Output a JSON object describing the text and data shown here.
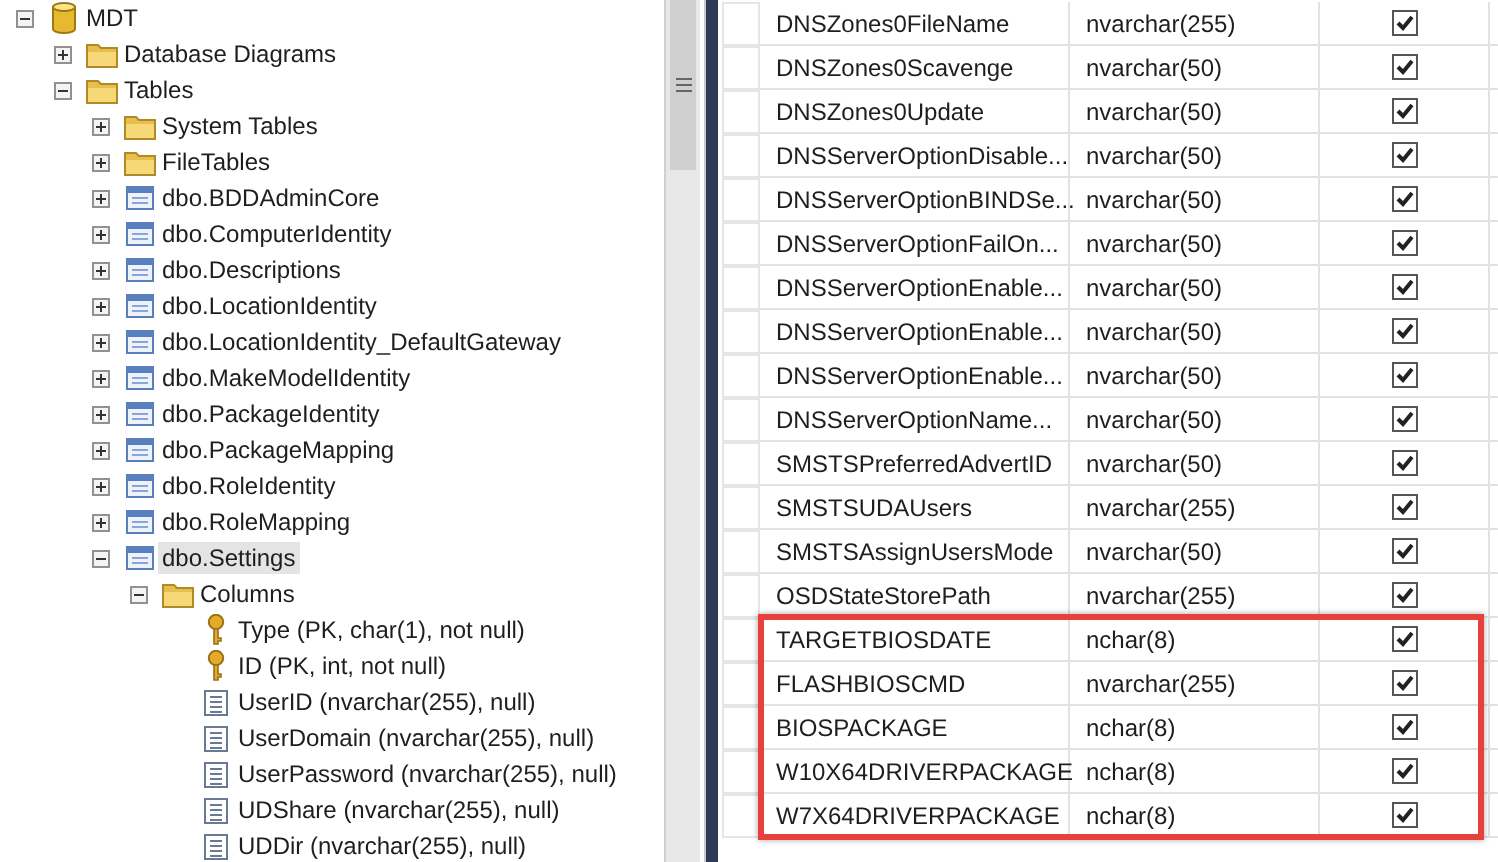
{
  "tree": [
    {
      "label": "MDT",
      "kind": "database",
      "expanded": true,
      "selected": false,
      "children": [
        {
          "label": "Database Diagrams",
          "kind": "folder",
          "expanded": false,
          "selected": false
        },
        {
          "label": "Tables",
          "kind": "folder",
          "expanded": true,
          "selected": false,
          "children": [
            {
              "label": "System Tables",
              "kind": "folder",
              "expanded": false,
              "selected": false
            },
            {
              "label": "FileTables",
              "kind": "folder",
              "expanded": false,
              "selected": false
            },
            {
              "label": "dbo.BDDAdminCore",
              "kind": "table",
              "expanded": false,
              "selected": false
            },
            {
              "label": "dbo.ComputerIdentity",
              "kind": "table",
              "expanded": false,
              "selected": false
            },
            {
              "label": "dbo.Descriptions",
              "kind": "table",
              "expanded": false,
              "selected": false
            },
            {
              "label": "dbo.LocationIdentity",
              "kind": "table",
              "expanded": false,
              "selected": false
            },
            {
              "label": "dbo.LocationIdentity_DefaultGateway",
              "kind": "table",
              "expanded": false,
              "selected": false
            },
            {
              "label": "dbo.MakeModelIdentity",
              "kind": "table",
              "expanded": false,
              "selected": false
            },
            {
              "label": "dbo.PackageIdentity",
              "kind": "table",
              "expanded": false,
              "selected": false
            },
            {
              "label": "dbo.PackageMapping",
              "kind": "table",
              "expanded": false,
              "selected": false
            },
            {
              "label": "dbo.RoleIdentity",
              "kind": "table",
              "expanded": false,
              "selected": false
            },
            {
              "label": "dbo.RoleMapping",
              "kind": "table",
              "expanded": false,
              "selected": false
            },
            {
              "label": "dbo.Settings",
              "kind": "table",
              "expanded": true,
              "selected": true,
              "children": [
                {
                  "label": "Columns",
                  "kind": "folder",
                  "expanded": true,
                  "selected": false,
                  "children": [
                    {
                      "label": "Type (PK, char(1), not null)",
                      "kind": "key",
                      "selected": false
                    },
                    {
                      "label": "ID (PK, int, not null)",
                      "kind": "key",
                      "selected": false
                    },
                    {
                      "label": "UserID (nvarchar(255), null)",
                      "kind": "column",
                      "selected": false
                    },
                    {
                      "label": "UserDomain (nvarchar(255), null)",
                      "kind": "column",
                      "selected": false
                    },
                    {
                      "label": "UserPassword (nvarchar(255), null)",
                      "kind": "column",
                      "selected": false
                    },
                    {
                      "label": "UDShare (nvarchar(255), null)",
                      "kind": "column",
                      "selected": false
                    },
                    {
                      "label": "UDDir (nvarchar(255), null)",
                      "kind": "column",
                      "selected": false
                    }
                  ]
                }
              ]
            }
          ]
        }
      ]
    }
  ],
  "columns_grid": {
    "rows": [
      {
        "name": "DNSZones0FileName",
        "type": "nvarchar(255)",
        "allow_nulls": true,
        "highlighted": false
      },
      {
        "name": "DNSZones0Scavenge",
        "type": "nvarchar(50)",
        "allow_nulls": true,
        "highlighted": false
      },
      {
        "name": "DNSZones0Update",
        "type": "nvarchar(50)",
        "allow_nulls": true,
        "highlighted": false
      },
      {
        "name": "DNSServerOptionDisable...",
        "type": "nvarchar(50)",
        "allow_nulls": true,
        "highlighted": false
      },
      {
        "name": "DNSServerOptionBINDSe...",
        "type": "nvarchar(50)",
        "allow_nulls": true,
        "highlighted": false
      },
      {
        "name": "DNSServerOptionFailOn...",
        "type": "nvarchar(50)",
        "allow_nulls": true,
        "highlighted": false
      },
      {
        "name": "DNSServerOptionEnable...",
        "type": "nvarchar(50)",
        "allow_nulls": true,
        "highlighted": false
      },
      {
        "name": "DNSServerOptionEnable...",
        "type": "nvarchar(50)",
        "allow_nulls": true,
        "highlighted": false
      },
      {
        "name": "DNSServerOptionEnable...",
        "type": "nvarchar(50)",
        "allow_nulls": true,
        "highlighted": false
      },
      {
        "name": "DNSServerOptionName...",
        "type": "nvarchar(50)",
        "allow_nulls": true,
        "highlighted": false
      },
      {
        "name": "SMSTSPreferredAdvertID",
        "type": "nvarchar(50)",
        "allow_nulls": true,
        "highlighted": false
      },
      {
        "name": "SMSTSUDAUsers",
        "type": "nvarchar(255)",
        "allow_nulls": true,
        "highlighted": false
      },
      {
        "name": "SMSTSAssignUsersMode",
        "type": "nvarchar(50)",
        "allow_nulls": true,
        "highlighted": false
      },
      {
        "name": "OSDStateStorePath",
        "type": "nvarchar(255)",
        "allow_nulls": true,
        "highlighted": false
      },
      {
        "name": "TARGETBIOSDATE",
        "type": "nchar(8)",
        "allow_nulls": true,
        "highlighted": true
      },
      {
        "name": "FLASHBIOSCMD",
        "type": "nvarchar(255)",
        "allow_nulls": true,
        "highlighted": true
      },
      {
        "name": "BIOSPACKAGE",
        "type": "nchar(8)",
        "allow_nulls": true,
        "highlighted": true
      },
      {
        "name": "W10X64DRIVERPACKAGE",
        "type": "nchar(8)",
        "allow_nulls": true,
        "highlighted": true
      },
      {
        "name": "W7X64DRIVERPACKAGE",
        "type": "nchar(8)",
        "allow_nulls": true,
        "highlighted": true
      }
    ]
  }
}
